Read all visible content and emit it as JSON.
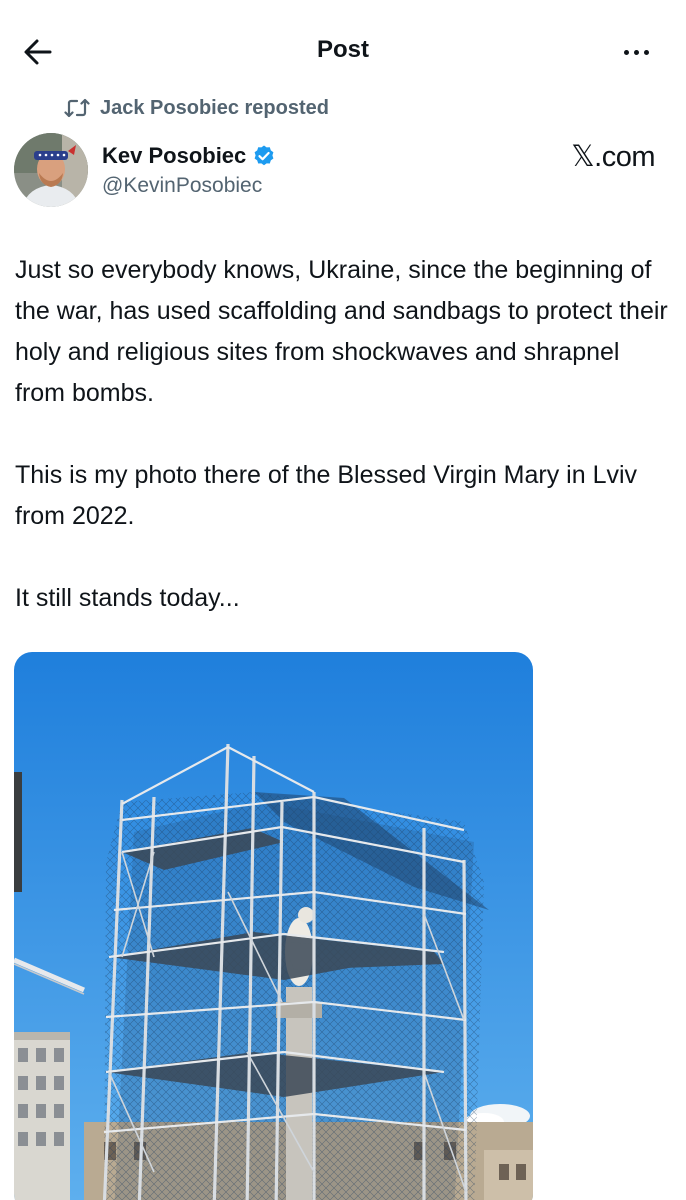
{
  "header": {
    "title": "Post",
    "back_icon": "arrow-left-icon",
    "more_icon": "more-horizontal-icon"
  },
  "repost": {
    "text": "Jack Posobiec reposted",
    "icon": "repost-icon"
  },
  "author": {
    "name": "Kev Posobiec",
    "handle": "@KevinPosobiec",
    "verified_color": "#1d9bf0"
  },
  "watermark": "𝕏.com",
  "tweet": {
    "paragraphs": [
      "Just so everybody knows, Ukraine, since the beginning of the war, has used scaffolding and sandbags to protect their holy and religious sites from shockwaves and shrapnel from bombs.",
      "This is my photo there of the Blessed Virgin Mary in Lviv from 2022.",
      "It still stands today..."
    ]
  },
  "media": {
    "sky_color": "#2f8ee4"
  }
}
